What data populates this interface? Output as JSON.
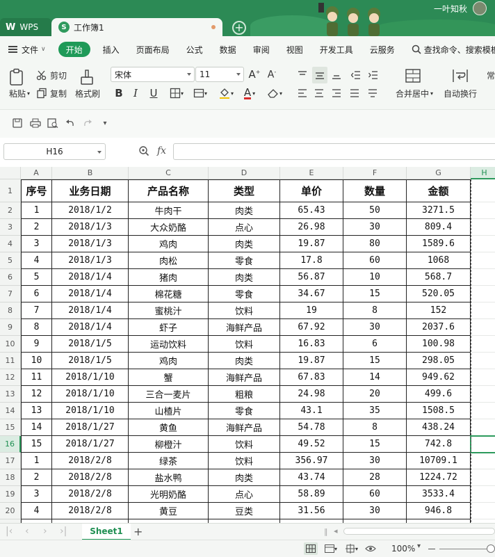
{
  "titlebar": {
    "app_tab": "WPS",
    "doc_tab": "工作簿1",
    "doc_icon_letter": "S",
    "user_name": "一叶知秋",
    "new_tab_icon": "plus-icon"
  },
  "menubar": {
    "file": "文件",
    "tabs": [
      "开始",
      "插入",
      "页面布局",
      "公式",
      "数据",
      "审阅",
      "视图",
      "开发工具",
      "云服务"
    ],
    "active_tab": "开始",
    "search_placeholder": "查找命令、搜索模板"
  },
  "ribbon": {
    "paste": "粘贴",
    "cut": "剪切",
    "copy": "复制",
    "format_painter": "格式刷",
    "font_name": "宋体",
    "font_size": "11",
    "merge_center": "合并居中",
    "wrap_text": "自动换行",
    "ellipsis": "常"
  },
  "formula_bar": {
    "cell_ref": "H16",
    "fx": "fx",
    "formula": ""
  },
  "grid": {
    "columns": [
      "A",
      "B",
      "C",
      "D",
      "E",
      "F",
      "G",
      "H"
    ],
    "rows": [
      "1",
      "2",
      "3",
      "4",
      "5",
      "6",
      "7",
      "8",
      "9",
      "10",
      "11",
      "12",
      "13",
      "14",
      "15",
      "16",
      "17",
      "18",
      "19",
      "20",
      "21"
    ],
    "selected_cell": "H16",
    "header_row": [
      "序号",
      "业务日期",
      "产品名称",
      "类型",
      "单价",
      "数量",
      "金额"
    ],
    "data_rows": [
      [
        "1",
        "2018/1/2",
        "牛肉干",
        "肉类",
        "65.43",
        "50",
        "3271.5"
      ],
      [
        "2",
        "2018/1/3",
        "大众奶酪",
        "点心",
        "26.98",
        "30",
        "809.4"
      ],
      [
        "3",
        "2018/1/3",
        "鸡肉",
        "肉类",
        "19.87",
        "80",
        "1589.6"
      ],
      [
        "4",
        "2018/1/3",
        "肉松",
        "零食",
        "17.8",
        "60",
        "1068"
      ],
      [
        "5",
        "2018/1/4",
        "猪肉",
        "肉类",
        "56.87",
        "10",
        "568.7"
      ],
      [
        "6",
        "2018/1/4",
        "棉花糖",
        "零食",
        "34.67",
        "15",
        "520.05"
      ],
      [
        "7",
        "2018/1/4",
        "蜜桃汁",
        "饮料",
        "19",
        "8",
        "152"
      ],
      [
        "8",
        "2018/1/4",
        "虾子",
        "海鲜产品",
        "67.92",
        "30",
        "2037.6"
      ],
      [
        "9",
        "2018/1/5",
        "运动饮料",
        "饮料",
        "16.83",
        "6",
        "100.98"
      ],
      [
        "10",
        "2018/1/5",
        "鸡肉",
        "肉类",
        "19.87",
        "15",
        "298.05"
      ],
      [
        "11",
        "2018/1/10",
        "蟹",
        "海鲜产品",
        "67.83",
        "14",
        "949.62"
      ],
      [
        "12",
        "2018/1/10",
        "三合一麦片",
        "粗粮",
        "24.98",
        "20",
        "499.6"
      ],
      [
        "13",
        "2018/1/10",
        "山楂片",
        "零食",
        "43.1",
        "35",
        "1508.5"
      ],
      [
        "14",
        "2018/1/27",
        "黄鱼",
        "海鲜产品",
        "54.78",
        "8",
        "438.24"
      ],
      [
        "15",
        "2018/1/27",
        "柳橙汁",
        "饮料",
        "49.52",
        "15",
        "742.8"
      ],
      [
        "1",
        "2018/2/8",
        "绿茶",
        "饮料",
        "356.97",
        "30",
        "10709.1"
      ],
      [
        "2",
        "2018/2/8",
        "盐水鸭",
        "肉类",
        "43.74",
        "28",
        "1224.72"
      ],
      [
        "3",
        "2018/2/8",
        "光明奶酪",
        "点心",
        "58.89",
        "60",
        "3533.4"
      ],
      [
        "4",
        "2018/2/8",
        "黄豆",
        "豆类",
        "31.56",
        "30",
        "946.8"
      ],
      [
        "",
        "",
        "",
        "",
        "",
        "",
        ""
      ]
    ]
  },
  "sheets": {
    "active": "Sheet1",
    "add_icon": "plus-icon"
  },
  "statusbar": {
    "zoom": "100%"
  },
  "colors": {
    "accent": "#1f9a58",
    "titlebar": "#2c8a55",
    "ribbon_bg": "#f4f7f4"
  }
}
